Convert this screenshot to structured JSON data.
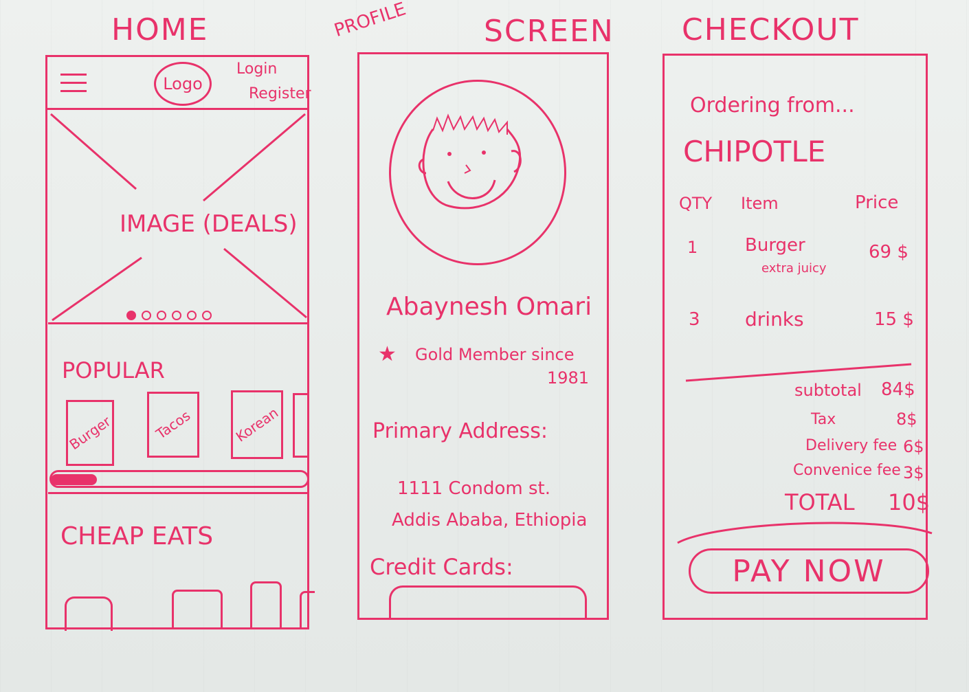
{
  "screens": {
    "home": {
      "title": "HOME",
      "header": {
        "logo": "Logo",
        "login": "Login",
        "register": "Register"
      },
      "hero": {
        "label": "IMAGE (DEALS)",
        "dots": 6,
        "active_dot": 0
      },
      "popular": {
        "heading": "POPULAR",
        "cards": [
          "Burger",
          "Tacos",
          "Korean"
        ],
        "scroll_progress": 0.18
      },
      "cheap_eats": {
        "heading": "CHEAP EATS"
      }
    },
    "profile": {
      "title_prefix": "PROFILE",
      "title": "SCREEN",
      "name": "Abaynesh Omari",
      "membership": "Gold Member since",
      "membership_year": "1981",
      "address_heading": "Primary Address:",
      "address_line1": "1111 Condom st.",
      "address_line2": "Addis Ababa, Ethiopia",
      "credit_heading": "Credit Cards:"
    },
    "checkout": {
      "title": "CHECKOUT",
      "ordering_from": "Ordering from...",
      "restaurant": "CHIPOTLE",
      "columns": [
        "QTY",
        "Item",
        "Price"
      ],
      "items": [
        {
          "qty": "1",
          "item": "Burger",
          "note": "extra juicy",
          "price": "69 $"
        },
        {
          "qty": "3",
          "item": "drinks",
          "note": "",
          "price": "15 $"
        }
      ],
      "summary": [
        {
          "label": "subtotal",
          "value": "84$"
        },
        {
          "label": "Tax",
          "value": "8$"
        },
        {
          "label": "Delivery fee",
          "value": "6$"
        },
        {
          "label": "Convenice fee",
          "value": "3$"
        }
      ],
      "total_label": "TOTAL",
      "total_value": "10$",
      "pay_button": "PAY NOW"
    }
  }
}
